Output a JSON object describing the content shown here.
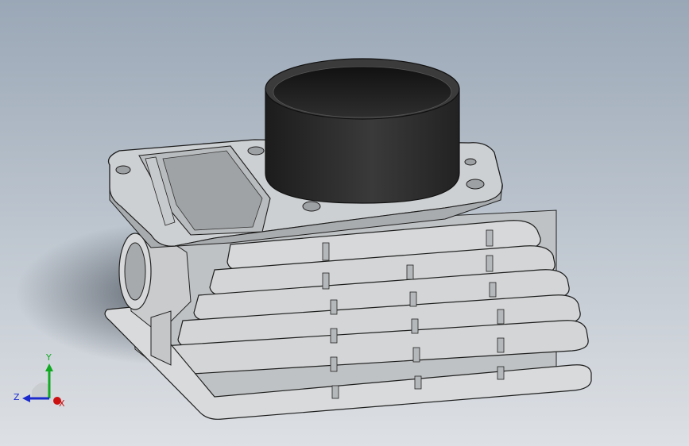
{
  "viewport": {
    "background_top": "#9aa7b6",
    "background_bottom": "#dde0e4"
  },
  "model": {
    "part": "cylinder-block",
    "fin_count": 6,
    "fin_color": "#d3d5d6",
    "body_color": "#c6c9cb",
    "sleeve_color": "#2a2a2a"
  },
  "triad": {
    "x_label": "X",
    "y_label": "Y",
    "z_label": "Z",
    "x_color": "#cc1111",
    "y_color": "#11aa22",
    "z_color": "#1a2acc"
  }
}
